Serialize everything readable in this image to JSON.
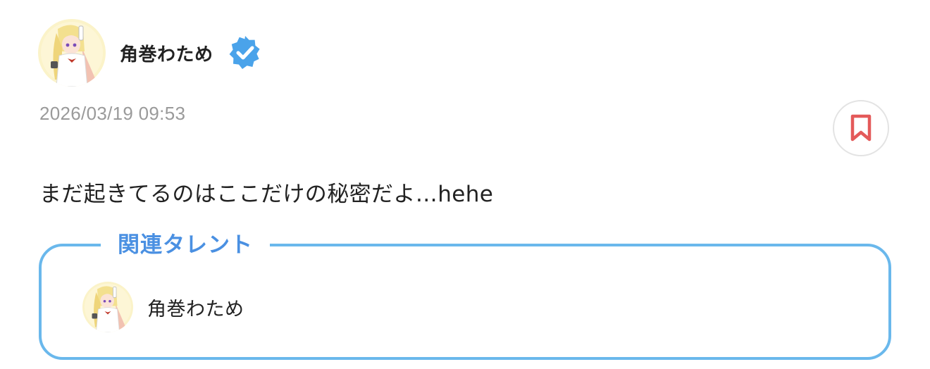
{
  "post": {
    "author": {
      "name": "角巻わため",
      "avatar_icon": "talent-avatar",
      "verified_icon": "verified-badge-icon"
    },
    "timestamp": "2026/03/19 09:53",
    "bookmark_icon": "bookmark-icon",
    "body": "まだ起きてるのはここだけの秘密だよ…hehe"
  },
  "related": {
    "title": "関連タレント",
    "talents": [
      {
        "name": "角巻わため",
        "avatar_icon": "talent-avatar"
      }
    ]
  },
  "colors": {
    "accent_blue": "#4a90e2",
    "border_blue": "#6ab8ec",
    "bookmark_red": "#e45a5a",
    "timestamp_gray": "#9a9a9a",
    "text": "#222222"
  }
}
